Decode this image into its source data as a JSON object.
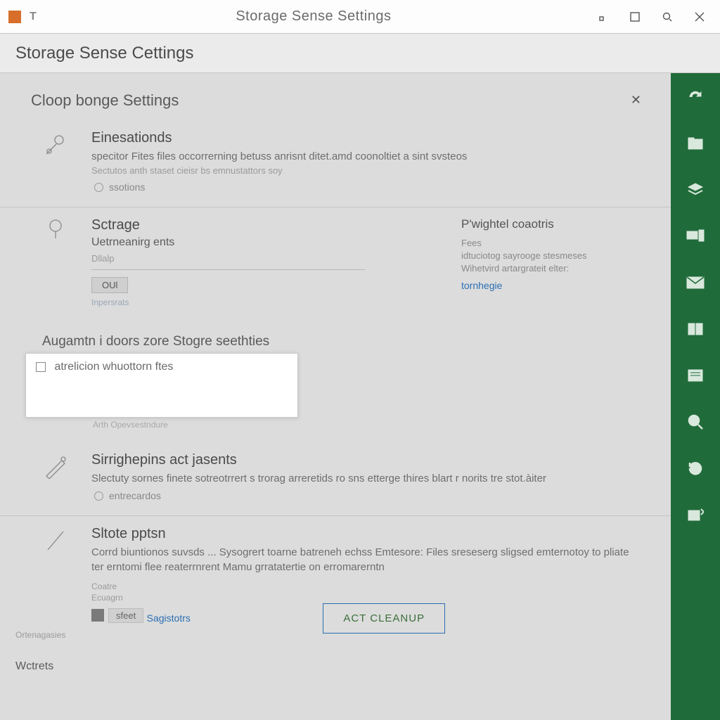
{
  "titlebar": {
    "title": "Storage Sense Settings"
  },
  "header": {
    "title": "Storage Sense Cettings"
  },
  "panel": {
    "title": "Cloop bonge Settings"
  },
  "sections": {
    "s1": {
      "head": "Einesationds",
      "sub": "specitor Fites files occorrerning betuss anrisnt ditet.amd coonoltiet a sint svsteos",
      "sub2": "Sectutos anth staset cieisr bs emnustattors soy",
      "radio": "ssotions"
    },
    "s2": {
      "head": "Sctrage",
      "sub": "Uetrneanirg ents",
      "sub2": "Dllalp",
      "pill": "OUl",
      "muted": "Inpersrats",
      "right_head": "P'wightel coaotris",
      "r1": "Fees",
      "r2": "idtuciotog sayrooge stesmeses",
      "r3": "Wihetvird artargrateit elter:",
      "r_link": "tornhegie"
    },
    "grouphead": "Augamtn i doors zore Stogre seethties",
    "popup_text": "atrelicion whuottorn ftes",
    "under_popup": "Arth Opevsestndure",
    "s3": {
      "head": "Sirrighepins act jasents",
      "sub": "Slectuty sornes finete sotreotrrert s trorag arreretids ro sns etterge thires blart r norits tre stot.àiter",
      "radio": "entrecardos"
    },
    "s4": {
      "head": "Sltote pptsn",
      "sub": "Corrd biuntionos suvsds ... Sysogrert toarne batreneh echss Emtesore: Files sreseserg sligsed emternotoy to pliate ter erntomi flee reaterrnrent Mamu grratatertie on erromarerntn",
      "lbl1": "Coatre",
      "lbl2": "Ecuagrn",
      "mini": "Ortenagasies",
      "chip": "sfeet",
      "sugg": "Sagistotrs",
      "btn": "ACT CLEANUP"
    }
  },
  "footer": "Wctrets"
}
